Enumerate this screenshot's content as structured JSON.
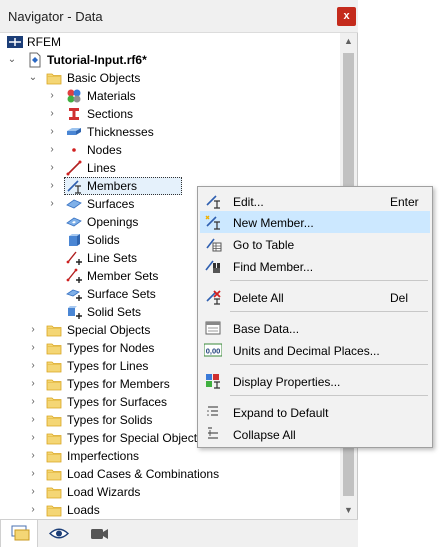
{
  "window": {
    "title": "Navigator - Data",
    "close_glyph": "x"
  },
  "tree": {
    "root": "RFEM",
    "model": "Tutorial-Input.rf6*",
    "basic_objects": "Basic Objects",
    "basic_items": [
      {
        "label": "Materials",
        "icon": "materials-icon"
      },
      {
        "label": "Sections",
        "icon": "sections-icon"
      },
      {
        "label": "Thicknesses",
        "icon": "thicknesses-icon"
      },
      {
        "label": "Nodes",
        "icon": "nodes-icon"
      },
      {
        "label": "Lines",
        "icon": "lines-icon"
      },
      {
        "label": "Members",
        "icon": "members-icon"
      },
      {
        "label": "Surfaces",
        "icon": "surfaces-icon"
      },
      {
        "label": "Openings",
        "icon": "openings-icon"
      },
      {
        "label": "Solids",
        "icon": "solids-icon"
      },
      {
        "label": "Line Sets",
        "icon": "line-sets-icon"
      },
      {
        "label": "Member Sets",
        "icon": "member-sets-icon"
      },
      {
        "label": "Surface Sets",
        "icon": "surface-sets-icon"
      },
      {
        "label": "Solid Sets",
        "icon": "solid-sets-icon"
      }
    ],
    "folders": [
      "Special Objects",
      "Types for Nodes",
      "Types for Lines",
      "Types for Members",
      "Types for Surfaces",
      "Types for Solids",
      "Types for Special Objects",
      "Imperfections",
      "Load Cases & Combinations",
      "Load Wizards",
      "Loads"
    ]
  },
  "context_menu": {
    "edit": {
      "label": "Edit...",
      "shortcut": "Enter"
    },
    "new_member": {
      "label": "New Member..."
    },
    "go_to_table": {
      "label": "Go to Table"
    },
    "find_member": {
      "label": "Find Member..."
    },
    "delete_all": {
      "label": "Delete All",
      "shortcut": "Del"
    },
    "base_data": {
      "label": "Base Data..."
    },
    "units": {
      "label": "Units and Decimal Places...",
      "icon_text": "0,00"
    },
    "display_properties": {
      "label": "Display Properties..."
    },
    "expand_default": {
      "label": "Expand to Default"
    },
    "collapse_all": {
      "label": "Collapse All"
    }
  },
  "colors": {
    "accent": "#0078d7",
    "highlight": "#cce8ff",
    "close": "#c42b1c",
    "folder": "#f4d675"
  }
}
